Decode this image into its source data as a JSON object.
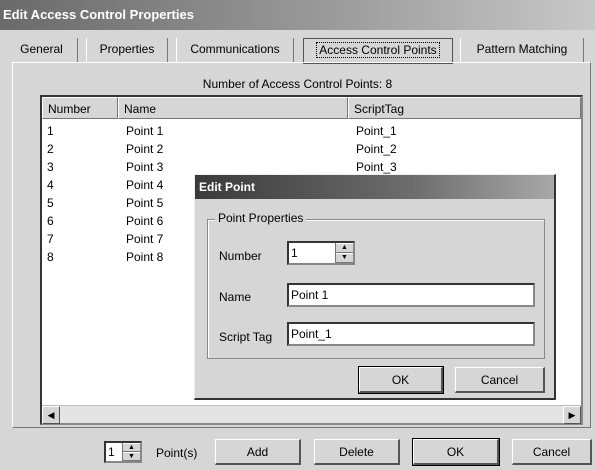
{
  "window": {
    "title": "Edit Access Control Properties"
  },
  "tabs": [
    {
      "label": "General"
    },
    {
      "label": "Properties"
    },
    {
      "label": "Communications"
    },
    {
      "label": "Access Control Points"
    },
    {
      "label": "Pattern Matching"
    }
  ],
  "active_tab": "Access Control Points",
  "summary": {
    "count_label": "Number of Access Control Points: 8"
  },
  "table": {
    "columns": [
      "Number",
      "Name",
      "ScriptTag"
    ],
    "rows": [
      [
        "1",
        "Point 1",
        "Point_1"
      ],
      [
        "2",
        "Point 2",
        "Point_2"
      ],
      [
        "3",
        "Point 3",
        "Point_3"
      ],
      [
        "4",
        "Point 4",
        ""
      ],
      [
        "5",
        "Point 5",
        ""
      ],
      [
        "6",
        "Point 6",
        ""
      ],
      [
        "7",
        "Point 7",
        ""
      ],
      [
        "8",
        "Point 8",
        ""
      ]
    ]
  },
  "bottom_bar": {
    "count_value": "1",
    "points_label": "Point(s)",
    "add_label": "Add",
    "delete_label": "Delete",
    "ok_label": "OK",
    "cancel_label": "Cancel"
  },
  "dialog": {
    "title": "Edit Point",
    "group_label": "Point Properties",
    "number_label": "Number",
    "number_value": "1",
    "name_label": "Name",
    "name_value": "Point 1",
    "script_tag_label": "Script Tag",
    "script_tag_value": "Point_1",
    "ok_label": "OK",
    "cancel_label": "Cancel"
  }
}
